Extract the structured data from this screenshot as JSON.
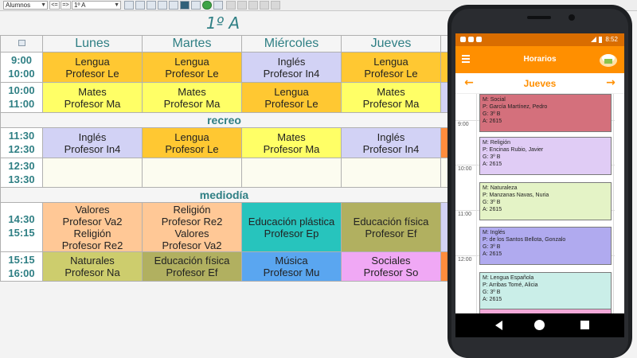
{
  "toolbar": {
    "view_select": "Alumnos",
    "prev_label": "<=",
    "next_label": "=>",
    "group_select": "1º A",
    "icons": [
      "print-icon",
      "grid-icon",
      "list-icon",
      "table-icon",
      "teacher-icon",
      "android-icon",
      "export-icon",
      "green-leaf-icon",
      "save-icon",
      "calendar-icon",
      "formula-icon",
      "chart-icon",
      "question-icon",
      "close-icon"
    ]
  },
  "schedule": {
    "title": "1º A",
    "days": [
      "Lunes",
      "Martes",
      "Miércoles",
      "Jueves"
    ],
    "rows": [
      {
        "type": "slot",
        "start": "9:00",
        "end": "10:00",
        "cells": [
          {
            "lines": [
              "Lengua",
              "Profesor Le"
            ],
            "color": "c-lengua"
          },
          {
            "lines": [
              "Lengua",
              "Profesor Le"
            ],
            "color": "c-lengua"
          },
          {
            "lines": [
              "Inglés",
              "Profesor In4"
            ],
            "color": "c-ingles"
          },
          {
            "lines": [
              "Lengua",
              "Profesor Le"
            ],
            "color": "c-lengua"
          },
          {
            "lines": [],
            "color": "c-lengua"
          }
        ]
      },
      {
        "type": "slot",
        "start": "10:00",
        "end": "11:00",
        "cells": [
          {
            "lines": [
              "Mates",
              "Profesor Ma"
            ],
            "color": "c-mates"
          },
          {
            "lines": [
              "Mates",
              "Profesor Ma"
            ],
            "color": "c-mates"
          },
          {
            "lines": [
              "Lengua",
              "Profesor Le"
            ],
            "color": "c-lengua"
          },
          {
            "lines": [
              "Mates",
              "Profesor Ma"
            ],
            "color": "c-mates"
          },
          {
            "lines": [],
            "color": "c-ingles"
          }
        ]
      },
      {
        "type": "break",
        "label": "recreo"
      },
      {
        "type": "slot",
        "start": "11:30",
        "end": "12:30",
        "cells": [
          {
            "lines": [
              "Inglés",
              "Profesor In4"
            ],
            "color": "c-ingles"
          },
          {
            "lines": [
              "Lengua",
              "Profesor Le"
            ],
            "color": "c-lengua"
          },
          {
            "lines": [
              "Mates",
              "Profesor Ma"
            ],
            "color": "c-mates"
          },
          {
            "lines": [
              "Inglés",
              "Profesor In4"
            ],
            "color": "c-ingles"
          },
          {
            "lines": [],
            "color": "c-orange"
          }
        ]
      },
      {
        "type": "slot",
        "start": "12:30",
        "end": "13:30",
        "cells": [
          {
            "lines": [],
            "color": "empty"
          },
          {
            "lines": [],
            "color": "empty"
          },
          {
            "lines": [],
            "color": "empty"
          },
          {
            "lines": [],
            "color": "empty"
          },
          {
            "lines": [],
            "color": "empty"
          }
        ]
      },
      {
        "type": "break",
        "label": "mediodía"
      },
      {
        "type": "slot",
        "start": "14:30",
        "end": "15:15",
        "cells": [
          {
            "lines": [
              "Valores",
              "Profesor Va2",
              "Religión",
              "Profesor Re2"
            ],
            "color": "c-valores"
          },
          {
            "lines": [
              "Religión",
              "Profesor Re2",
              "Valores",
              "Profesor Va2"
            ],
            "color": "c-valores"
          },
          {
            "lines": [
              "Educación plástica",
              "Profesor Ep"
            ],
            "color": "c-plastica"
          },
          {
            "lines": [
              "Educación física",
              "Profesor Ef"
            ],
            "color": "c-fisica"
          },
          {
            "lines": [],
            "color": "c-ingles"
          }
        ]
      },
      {
        "type": "slot",
        "start": "15:15",
        "end": "16:00",
        "cells": [
          {
            "lines": [
              "Naturales",
              "Profesor Na"
            ],
            "color": "c-naturales"
          },
          {
            "lines": [
              "Educación física",
              "Profesor Ef"
            ],
            "color": "c-fisica"
          },
          {
            "lines": [
              "Música",
              "Profesor Mu"
            ],
            "color": "c-musica"
          },
          {
            "lines": [
              "Sociales",
              "Profesor So"
            ],
            "color": "c-sociales"
          },
          {
            "lines": [],
            "color": "c-orange"
          }
        ]
      }
    ]
  },
  "phone": {
    "status_time": "8:52",
    "app_title": "Horarios",
    "day": "Jueves",
    "hours": [
      "9:00",
      "10:00",
      "11:00",
      "12:00"
    ],
    "events": [
      {
        "class": "ev-social",
        "lines": [
          "M: Social",
          "P: García Martínez, Pedro",
          "G: 3º B",
          "A: 2615"
        ]
      },
      {
        "class": "ev-religion",
        "lines": [
          "M: Religión",
          "P: Encinas Rubio, Javier",
          "G: 3º B",
          "A: 2615"
        ]
      },
      {
        "class": "ev-naturaleza",
        "lines": [
          "M: Naturaleza",
          "P: Manzanas Navas, Nuria",
          "G: 3º B",
          "A: 2615"
        ]
      },
      {
        "class": "ev-ingles",
        "lines": [
          "M: Inglés",
          "P: de los Santos Bellota, Gonzalo",
          "G: 3º B",
          "A: 2615"
        ]
      },
      {
        "class": "ev-lengua",
        "lines": [
          "M: Lengua Española",
          "P: Arribas Tomé, Alicia",
          "G: 3º B",
          "A: 2615"
        ]
      },
      {
        "class": "ev-next",
        "lines": []
      }
    ],
    "colors": {
      "accent": "#ff8f00",
      "statusbar": "#d96d00"
    }
  }
}
